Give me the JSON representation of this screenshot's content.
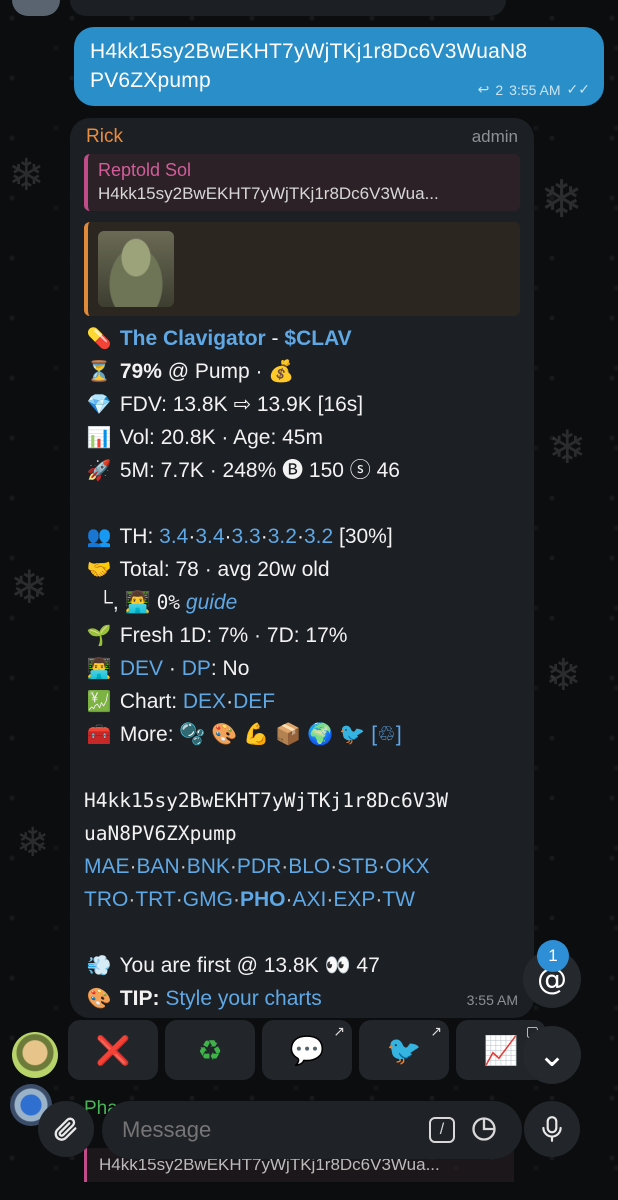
{
  "colors": {
    "outgoing_bubble": "#2a8fc8",
    "incoming_bubble": "#1c1f23",
    "link": "#5fa8e6",
    "sender": "#e98c3e",
    "reply_accent": "#c24c89",
    "badge": "#2e8fd6"
  },
  "outgoing": {
    "text_line1": "H4kk15sy2BwEKHT7yWjTKj1r8Dc6V3WuaN8",
    "text_line2": "PV6ZXpump",
    "reply_count": "2",
    "time": "3:55 AM",
    "status_icon": "double-check-icon"
  },
  "incoming": {
    "sender": "Rick",
    "role": "admin",
    "reply": {
      "name": "Reptold Sol",
      "text": "H4kk15sy2BwEKHT7yWjTKj1r8Dc6V3Wua..."
    },
    "time": "3:55 AM",
    "line_title": {
      "emoji": "💊",
      "name": "The Clavigator",
      "sep": " - ",
      "ticker": "$CLAV"
    },
    "line_progress": {
      "emoji": "⏳",
      "pct": "79%",
      "rest": " @ Pump · ",
      "emoji2": "💰"
    },
    "line_fdv": {
      "emoji": "💎",
      "text": "FDV: 13.8K ⇨ 13.9K [16s]"
    },
    "line_vol": {
      "emoji": "📊",
      "text": "Vol: 20.8K · Age: 45m"
    },
    "line_5m": {
      "emoji": "🚀",
      "text": "5M: 7.7K · 248% 🅑 150 ⓢ 46"
    },
    "line_th": {
      "emoji": "👥",
      "label": "TH: ",
      "v1": "3.4",
      "v2": "3.4",
      "v3": "3.3",
      "v4": "3.2",
      "v5": "3.2",
      "tail": " [30%]",
      "dot": "·"
    },
    "line_total": {
      "emoji": "🤝",
      "text": "Total: 78 · avg 20w old"
    },
    "line_guide": {
      "prefix": "└,",
      "emoji": "👨‍💻",
      "pct": "0%",
      "link": "guide"
    },
    "line_fresh": {
      "emoji": "🌱",
      "text": "Fresh 1D: 7% · 7D: 17%"
    },
    "line_dev": {
      "emoji": "👨‍💻",
      "dev": "DEV",
      "sep": " · ",
      "dp": "DP",
      "rest": ": No"
    },
    "line_chart": {
      "emoji": "💹",
      "label": "Chart: ",
      "l1": "DEX",
      "dot": "·",
      "l2": "DEF"
    },
    "line_more": {
      "emoji": "🧰",
      "label": "More: ",
      "icons": "🫧 🎨 💪 📦 🌍 🐦 [♲]"
    },
    "address_line1": "H4kk15sy2BwEKHT7yWjTKj1r8Dc6V3W",
    "address_line2": "uaN8PV6ZXpump",
    "links_row1": [
      "MAE",
      "BAN",
      "BNK",
      "PDR",
      "BLO",
      "STB",
      "OKX"
    ],
    "links_row2": [
      "TRO",
      "TRT",
      "GMG",
      "PHO",
      "AXI",
      "EXP",
      "TW"
    ],
    "link_dot": "·",
    "line_first": {
      "emoji": "💨",
      "text": "You are first @ 13.8K 👀 47"
    },
    "line_tip": {
      "emoji": "🎨",
      "label": "TIP: ",
      "link": "Style your charts"
    }
  },
  "keyboard": [
    {
      "icon": "❌",
      "name": "cancel-icon",
      "corner": ""
    },
    {
      "icon": "♻",
      "name": "recycle-icon",
      "corner": ""
    },
    {
      "icon": "💬",
      "name": "chat-bubble-icon",
      "corner": "↗"
    },
    {
      "icon": "🐦",
      "name": "bird-icon",
      "corner": "↗"
    },
    {
      "icon": "📈",
      "name": "chart-icon",
      "corner": "▢"
    }
  ],
  "mention_badge": "1",
  "mention_symbol": "@",
  "scroll_down_symbol": "⌄",
  "below": {
    "sender": "Pha",
    "reply_text": "H4kk15sy2BwEKHT7yWjTKj1r8Dc6V3Wua..."
  },
  "composer": {
    "placeholder": "Message",
    "attach_icon": "paperclip-icon",
    "mic_icon": "microphone-icon",
    "command_icon": "slash-command-icon",
    "sticker_icon": "sticker-icon"
  }
}
